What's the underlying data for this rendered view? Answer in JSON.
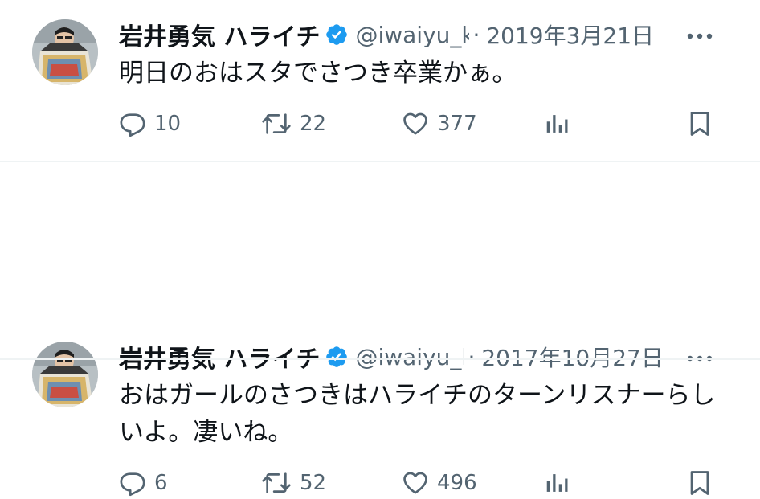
{
  "tweets": [
    {
      "author_name": "岩井勇気 ハライチ",
      "handle": "@iwaiyu_ki",
      "separator": "·",
      "date": "2019年3月21日",
      "text": "明日のおはスタでさつき卒業かぁ。",
      "replies": "10",
      "retweets": "22",
      "likes": "377"
    },
    {
      "author_name": "岩井勇気 ハライチ",
      "handle": "@iwaiyu_k",
      "separator": "·",
      "date": "2017年10月27日",
      "text": "おはガールのさつきはハライチのターンリスナーらしいよ。凄いね。",
      "replies": "6",
      "retweets": "52",
      "likes": "496"
    }
  ],
  "icons": {
    "reply": "reply-icon",
    "retweet": "retweet-icon",
    "like": "heart-icon",
    "views": "views-icon",
    "bookmark": "bookmark-icon",
    "more": "more-icon",
    "verified": "verified-badge-icon"
  },
  "colors": {
    "text_primary": "#0f1419",
    "text_secondary": "#536471",
    "verified_blue": "#1d9bf0",
    "divider": "#eff3f4"
  }
}
